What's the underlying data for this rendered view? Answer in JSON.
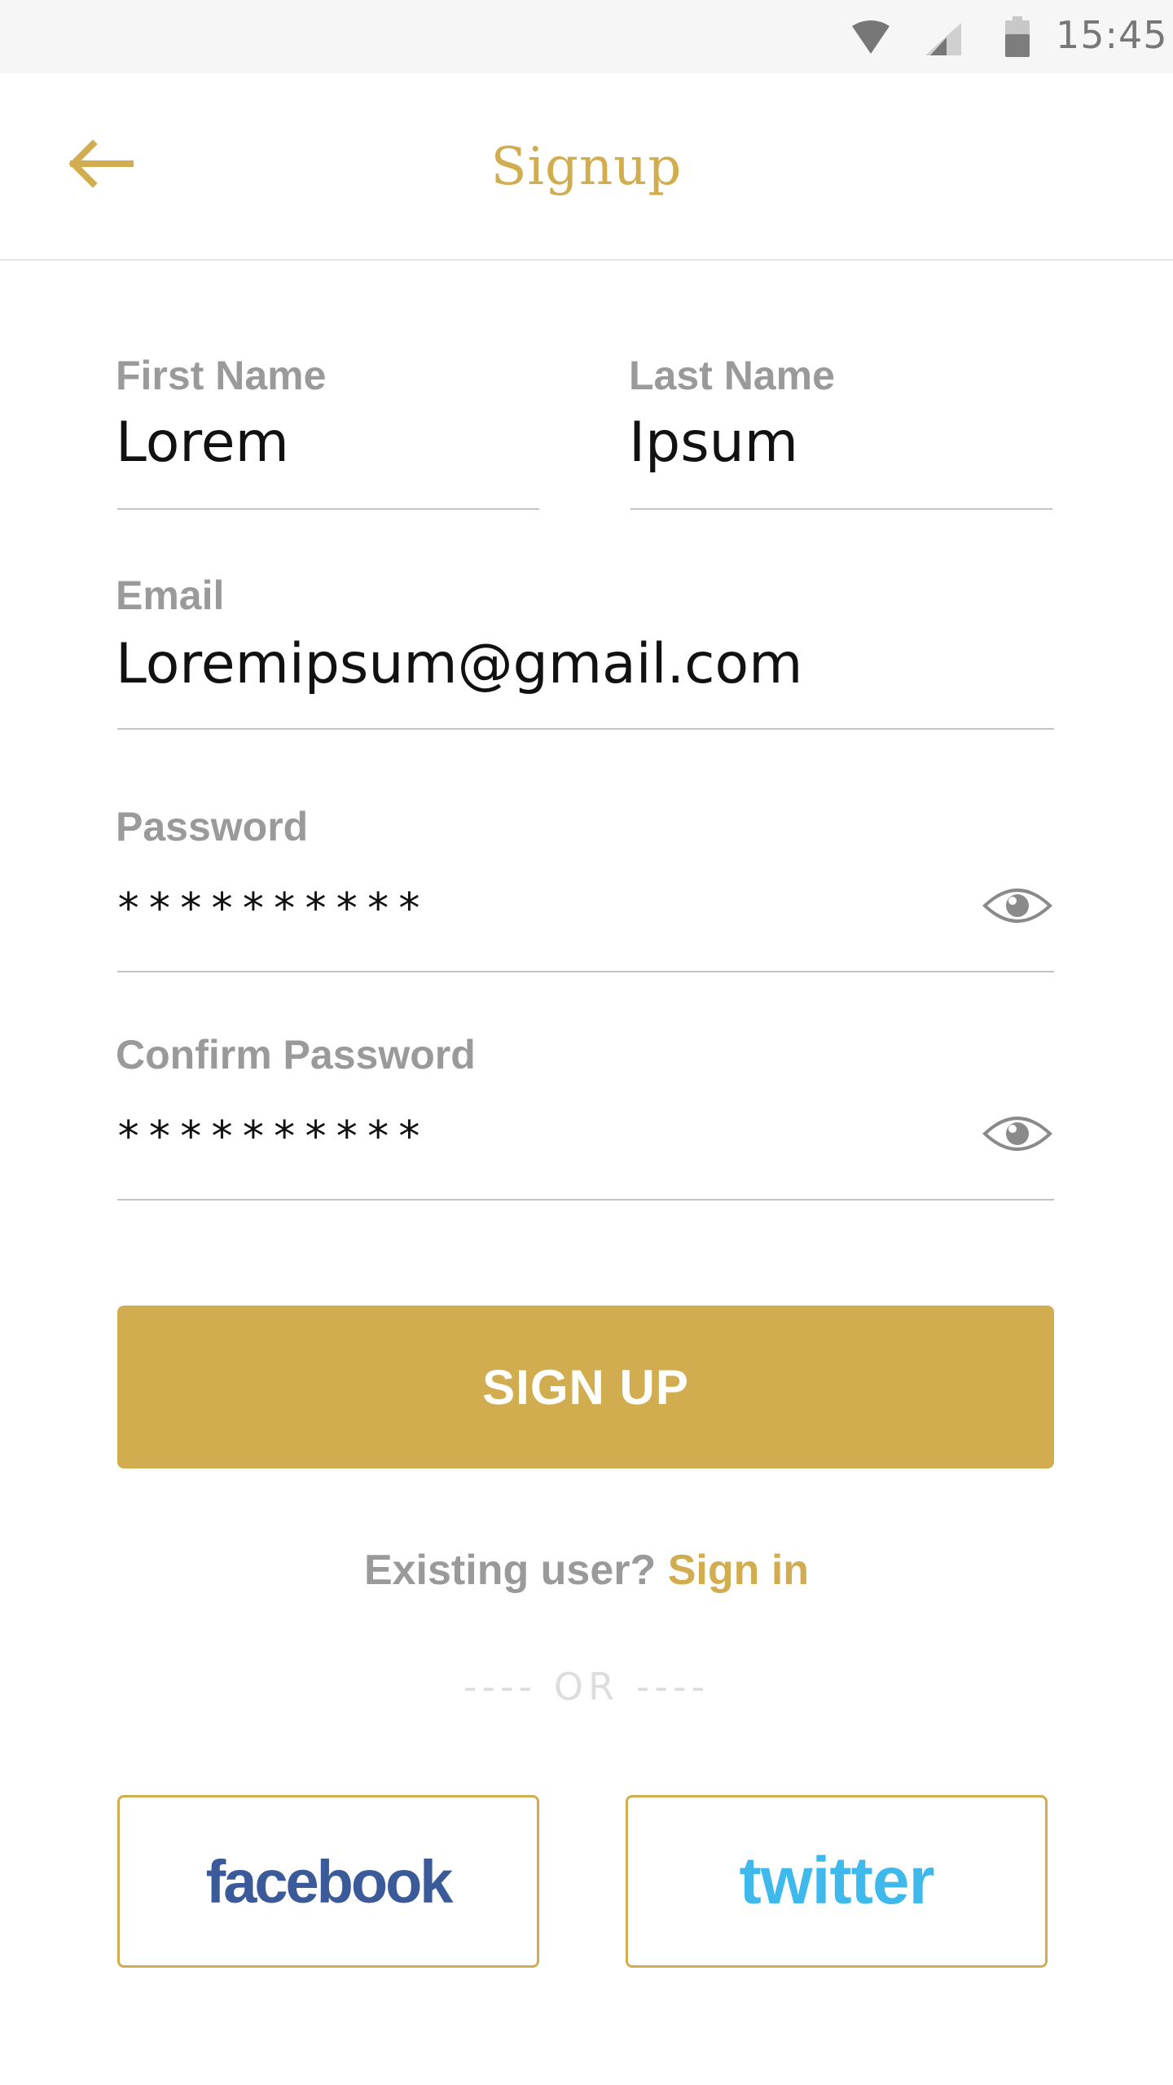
{
  "status_bar": {
    "time": "15:45",
    "icons": [
      "wifi-icon",
      "cellular-signal-icon",
      "battery-icon"
    ]
  },
  "header": {
    "title": "Signup",
    "back_icon": "arrow-left-icon"
  },
  "form": {
    "first_name": {
      "label": "First Name",
      "value": "Lorem"
    },
    "last_name": {
      "label": "Last Name",
      "value": "Ipsum"
    },
    "email": {
      "label": "Email",
      "value": "Loremipsum@gmail.com"
    },
    "password": {
      "label": "Password",
      "value": "**********",
      "toggle_icon": "eye-icon"
    },
    "confirm_password": {
      "label": "Confirm Password",
      "value": "**********",
      "toggle_icon": "eye-icon"
    }
  },
  "actions": {
    "signup_label": "SIGN UP",
    "existing_user_text": "Existing user?",
    "signin_label": "Sign in",
    "or_text": "---- OR ----"
  },
  "social": {
    "facebook_label": "facebook",
    "twitter_label": "twitter"
  },
  "colors": {
    "accent": "#d2ad50",
    "label_gray": "#9a9a9a",
    "facebook_blue": "#3b5a9a",
    "twitter_blue": "#3fb9ec"
  }
}
